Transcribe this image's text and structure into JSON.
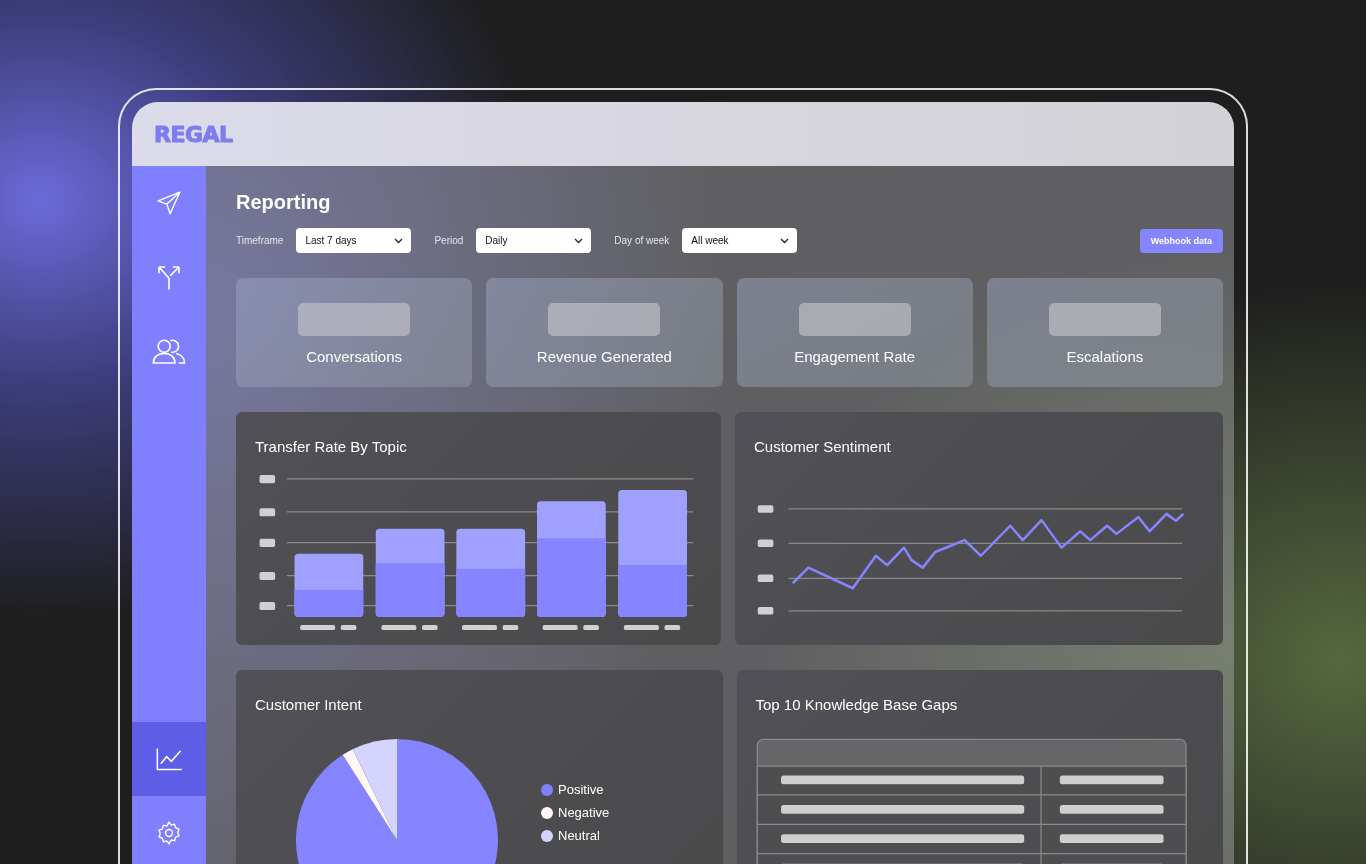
{
  "header": {
    "logo": "REGAL"
  },
  "sidebar": {
    "items": [
      {
        "kind": "send",
        "selected": false
      },
      {
        "kind": "split",
        "selected": false
      },
      {
        "kind": "users",
        "selected": false
      },
      {
        "kind": "chart",
        "selected": true
      },
      {
        "kind": "settings",
        "selected": false
      }
    ]
  },
  "page": {
    "title": "Reporting"
  },
  "filters": [
    {
      "label": "Timeframe",
      "value": "Last 7 days"
    },
    {
      "label": "Period",
      "value": "Daily"
    },
    {
      "label": "Day of week",
      "value": "All week"
    }
  ],
  "actions": {
    "button": "Webhook data"
  },
  "stats": [
    {
      "label": "Conversations"
    },
    {
      "label": "Revenue Generated"
    },
    {
      "label": "Engagement Rate"
    },
    {
      "label": "Escalations"
    }
  ],
  "transfer_rate": {
    "title": "Transfer Rate By Topic"
  },
  "sentiment": {
    "title": "Customer Sentiment"
  },
  "intent": {
    "title": "Customer Intent",
    "legend": [
      {
        "label": "Positive",
        "color": "#8080ff"
      },
      {
        "label": "Negative",
        "color": "#fff6f6"
      },
      {
        "label": "Neutral",
        "color": "#d4d4ff"
      }
    ]
  },
  "gaps": {
    "title": "Top 10 Knowledge Base Gaps"
  }
}
